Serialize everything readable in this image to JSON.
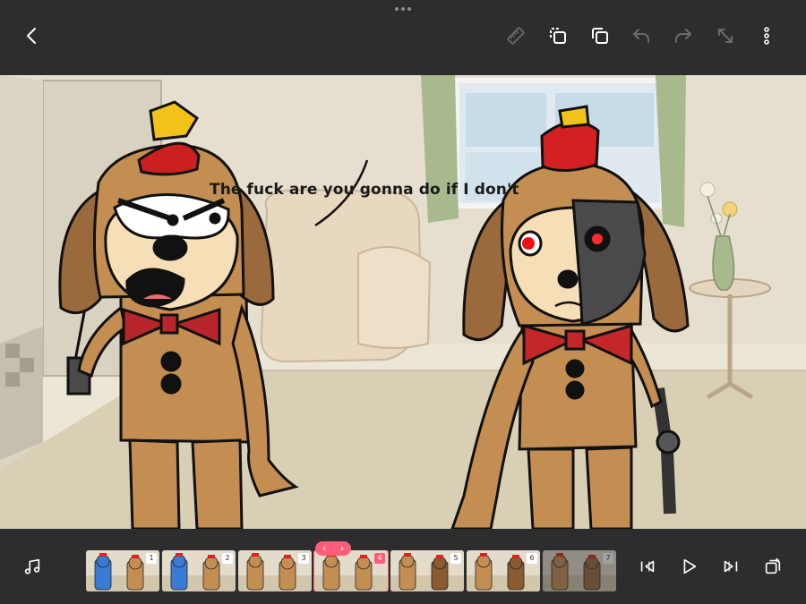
{
  "toolbar": {
    "back_icon": "chevron-left-icon",
    "icons": [
      "ruler-icon",
      "copy-frame-icon",
      "duplicate-layer-icon",
      "undo-icon",
      "redo-icon",
      "resize-icon",
      "more-vertical-icon"
    ]
  },
  "canvas": {
    "speech_text": "The fuck are you gonna do if I don't"
  },
  "timeline": {
    "frames": [
      {
        "number": "1"
      },
      {
        "number": "2"
      },
      {
        "number": "3"
      },
      {
        "number": "4"
      },
      {
        "number": "5"
      },
      {
        "number": "6"
      },
      {
        "number": "7"
      }
    ],
    "selected_frame": "4",
    "handle_prev": "‹",
    "handle_next": "›"
  },
  "bottom_controls": {
    "left_icon": "music-note-icon",
    "icons": [
      "skip-to-start-icon",
      "play-icon",
      "skip-to-end-icon",
      "add-frame-icon"
    ]
  },
  "colors": {
    "accent": "#ff5d7a",
    "bar": "#2d2d2f",
    "icon": "#ffffff",
    "icon_disabled": "#6b6b6d"
  }
}
